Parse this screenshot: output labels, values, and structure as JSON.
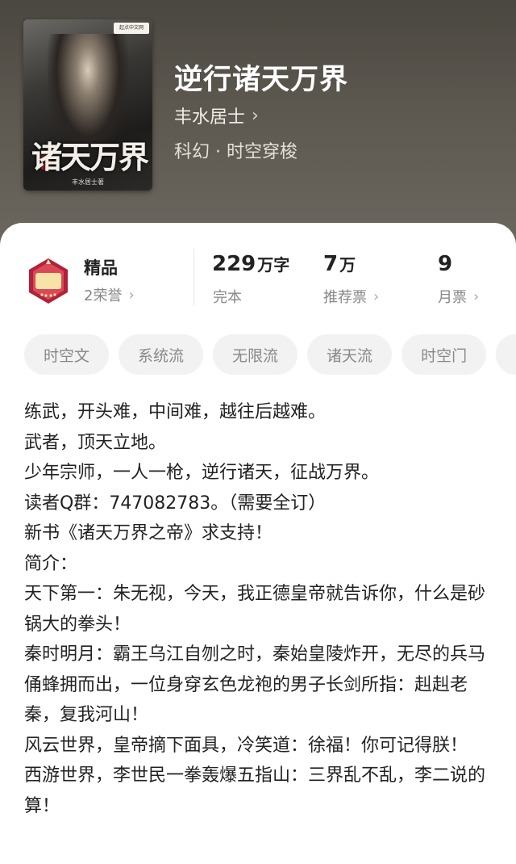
{
  "book": {
    "title": "逆行诸天万界",
    "author": "丰水居士",
    "genre": "科幻 · 时空穿梭",
    "cover": {
      "title_art": "诸天万界",
      "author_small": "丰水居士著",
      "publisher_badge": "起点中文网"
    }
  },
  "stats": {
    "quality": {
      "label": "精品",
      "honor": "2荣誉"
    },
    "words": {
      "value": "229",
      "unit": "万字",
      "status": "完本"
    },
    "recommend": {
      "value": "7",
      "unit": "万",
      "label": "推荐票"
    },
    "monthly": {
      "value": "9",
      "label": "月票"
    }
  },
  "tags": [
    "时空文",
    "系统流",
    "无限流",
    "诸天流",
    "时空门",
    ""
  ],
  "intro": [
    "练武，开头难，中间难，越往后越难。",
    "武者，顶天立地。",
    "少年宗师，一人一枪，逆行诸天，征战万界。",
    "读者Q群：747082783。（需要全订）",
    "新书《诸天万界之帝》求支持！",
    "简介：",
    "天下第一：朱无视，今天，我正德皇帝就告诉你，什么是砂锅大的拳头！",
    "秦时明月：霸王乌江自刎之时，秦始皇陵炸开，无尽的兵马俑蜂拥而出，一位身穿玄色龙袍的男子长剑所指：赳赳老秦，复我河山！",
    "风云世界，皇帝摘下面具，冷笑道：徐福！你可记得朕！",
    "西游世界，李世民一拳轰爆五指山：三界乱不乱，李二说的算！"
  ],
  "colors": {
    "hero_bg": "#5c5850",
    "tag_bg": "#f2f2f2",
    "medal_primary": "#b3203a"
  }
}
